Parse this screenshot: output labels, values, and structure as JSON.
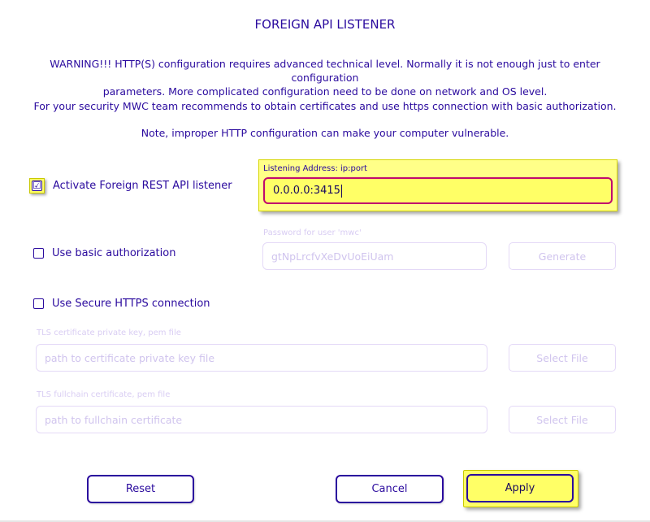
{
  "title": "FOREIGN API LISTENER",
  "warning_line1": "WARNING!!!  HTTP(S) configuration requires advanced technical level. Normally it is not enough just to enter configuration",
  "warning_line2": "parameters. More complicated configuration need to be done on network and OS level.",
  "security_note": "For your security MWC team recommends to obtain certificates and use https connection with basic authorization.",
  "vulnerable_note": "Note, improper HTTP configuration can make your computer vulnerable.",
  "activate": {
    "label": "Activate Foreign REST API listener",
    "checked": true,
    "check_glyph": "☑"
  },
  "listening": {
    "label": "Listening Address: ip:port",
    "value": "0.0.0.0:3415"
  },
  "basic_auth": {
    "label": "Use basic authorization",
    "checked": false
  },
  "password": {
    "label": "Password for user 'mwc'",
    "value": "gtNpLrcfvXeDvUoEiUam",
    "generate_label": "Generate"
  },
  "https": {
    "label": "Use Secure HTTPS connection",
    "checked": false
  },
  "tls_key": {
    "label": "TLS certificate private key, pem file",
    "placeholder": "path to certificate private key file",
    "select_label": "Select File"
  },
  "tls_chain": {
    "label": "TLS fullchain certificate, pem file",
    "placeholder": "path to fullchain certificate",
    "select_label": "Select File"
  },
  "buttons": {
    "reset": "Reset",
    "cancel": "Cancel",
    "apply": "Apply"
  },
  "colors": {
    "accent": "#2a0a9e",
    "focus": "#ffff66",
    "focus_border": "#c00a6e",
    "disabled": "#d0c4ee"
  }
}
